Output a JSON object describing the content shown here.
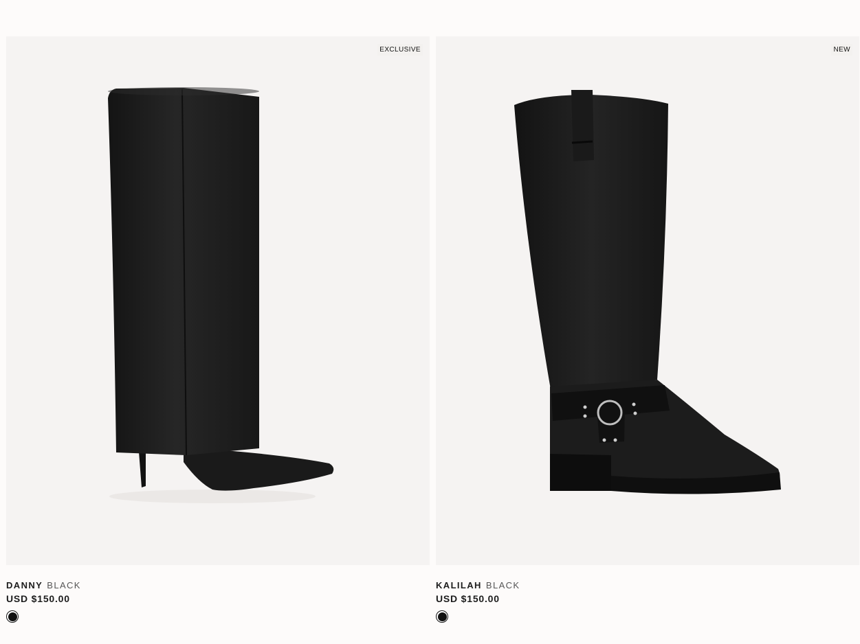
{
  "products": [
    {
      "badge": "EXCLUSIVE",
      "name": "DANNY",
      "color_name": "BLACK",
      "price": "USD $150.00",
      "swatch_color": "#111111",
      "image_icon": "fold-over-knee-boot"
    },
    {
      "badge": "NEW",
      "name": "KALILAH",
      "color_name": "BLACK",
      "price": "USD $150.00",
      "swatch_color": "#111111",
      "image_icon": "harness-knee-boot"
    }
  ]
}
